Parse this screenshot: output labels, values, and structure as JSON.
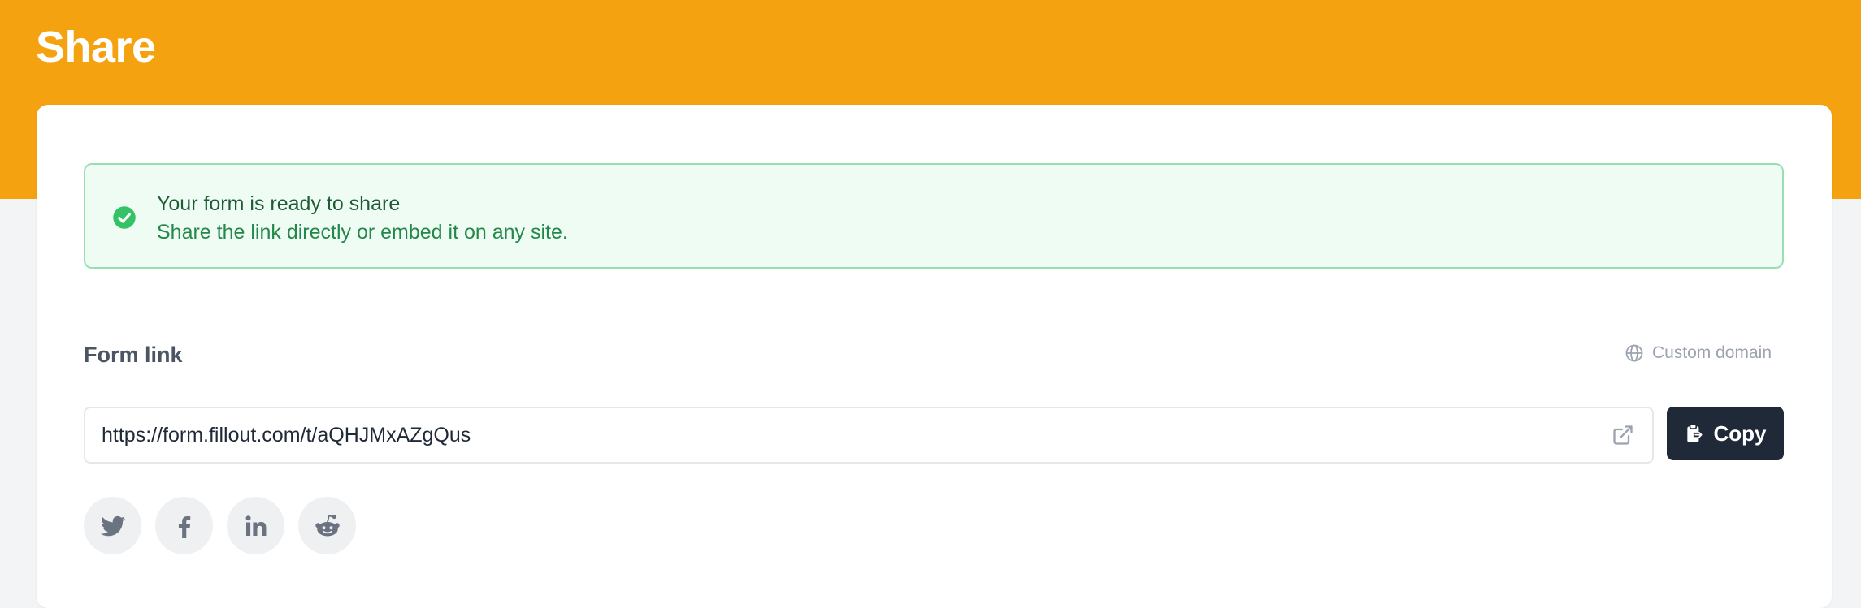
{
  "header": {
    "title": "Share",
    "color": "#f4a20f"
  },
  "alert": {
    "icon": "check-circle-icon",
    "title": "Your form is ready to share",
    "message": "Share the link directly or embed it on any site.",
    "color": "#23884a"
  },
  "form_link": {
    "label": "Form link",
    "custom_domain_label": "Custom domain",
    "custom_domain_icon": "globe-icon",
    "url": "https://form.fillout.com/t/aQHJMxAZgQus",
    "open_icon": "external-link-icon",
    "copy_label": "Copy",
    "copy_icon": "clipboard-icon"
  },
  "social": [
    {
      "name": "twitter",
      "icon": "twitter-icon"
    },
    {
      "name": "facebook",
      "icon": "facebook-icon"
    },
    {
      "name": "linkedin",
      "icon": "linkedin-icon"
    },
    {
      "name": "reddit",
      "icon": "reddit-icon"
    }
  ]
}
